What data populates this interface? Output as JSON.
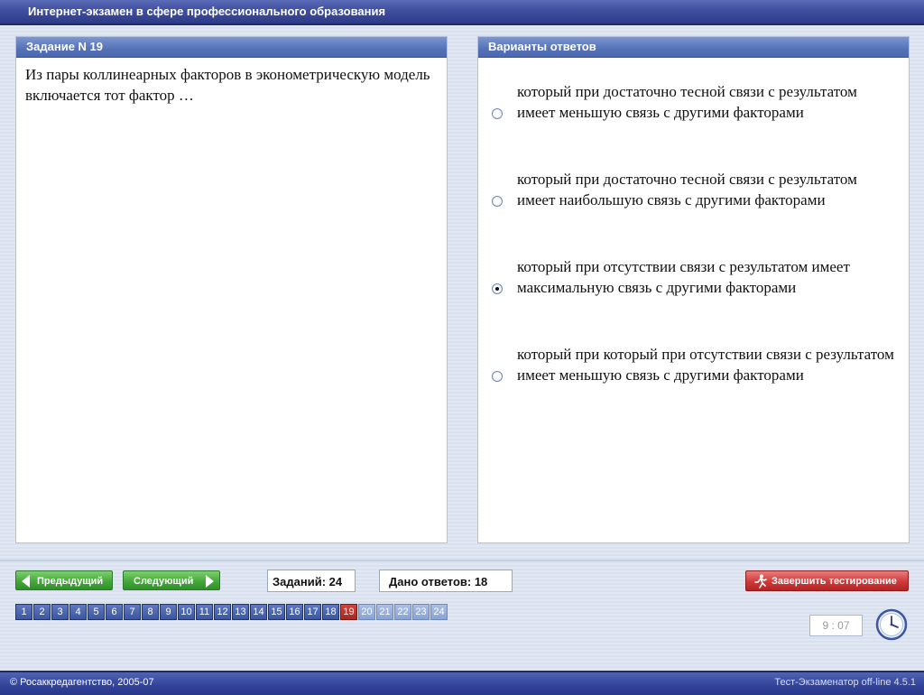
{
  "window": {
    "title": "Интернет-экзамен в сфере профессионального образования"
  },
  "task": {
    "header": "Задание N 19",
    "question": "Из пары коллинеарных факторов в эконометрическую модель включается тот фактор …"
  },
  "answers": {
    "header": "Варианты ответов",
    "options": [
      {
        "text": "который при достаточно тесной связи с результатом имеет меньшую связь с другими факторами",
        "selected": false
      },
      {
        "text": "который при достаточно тесной связи с результатом имеет наибольшую связь с другими факторами",
        "selected": false
      },
      {
        "text": "который при отсутствии связи с результатом имеет максимальную связь с другими факторами",
        "selected": true
      },
      {
        "text": "который при который при отсутствии связи с результатом имеет меньшую связь с другими факторами",
        "selected": false
      }
    ]
  },
  "nav": {
    "prev_label": "Предыдущий",
    "next_label": "Следующий",
    "tasks_count": "Заданий: 24",
    "answers_given": "Дано ответов: 18",
    "finish_label": "Завершить тестирование",
    "pages": [
      "1",
      "2",
      "3",
      "4",
      "5",
      "6",
      "7",
      "8",
      "9",
      "10",
      "11",
      "12",
      "13",
      "14",
      "15",
      "16",
      "17",
      "18",
      "19",
      "20",
      "21",
      "22",
      "23",
      "24"
    ],
    "current_page": "19"
  },
  "timer": {
    "value": "9 : 07"
  },
  "footer": {
    "left": "© Росаккредагентство, 2005-07",
    "right": "Тест-Экзаменатор off-line 4.5.1"
  },
  "colors": {
    "title_bar": "#3f4e9f",
    "panel_header": "#5572b8",
    "nav_green": "#45a83a",
    "finish_red": "#cf3a3a",
    "current_page": "#a82820"
  }
}
